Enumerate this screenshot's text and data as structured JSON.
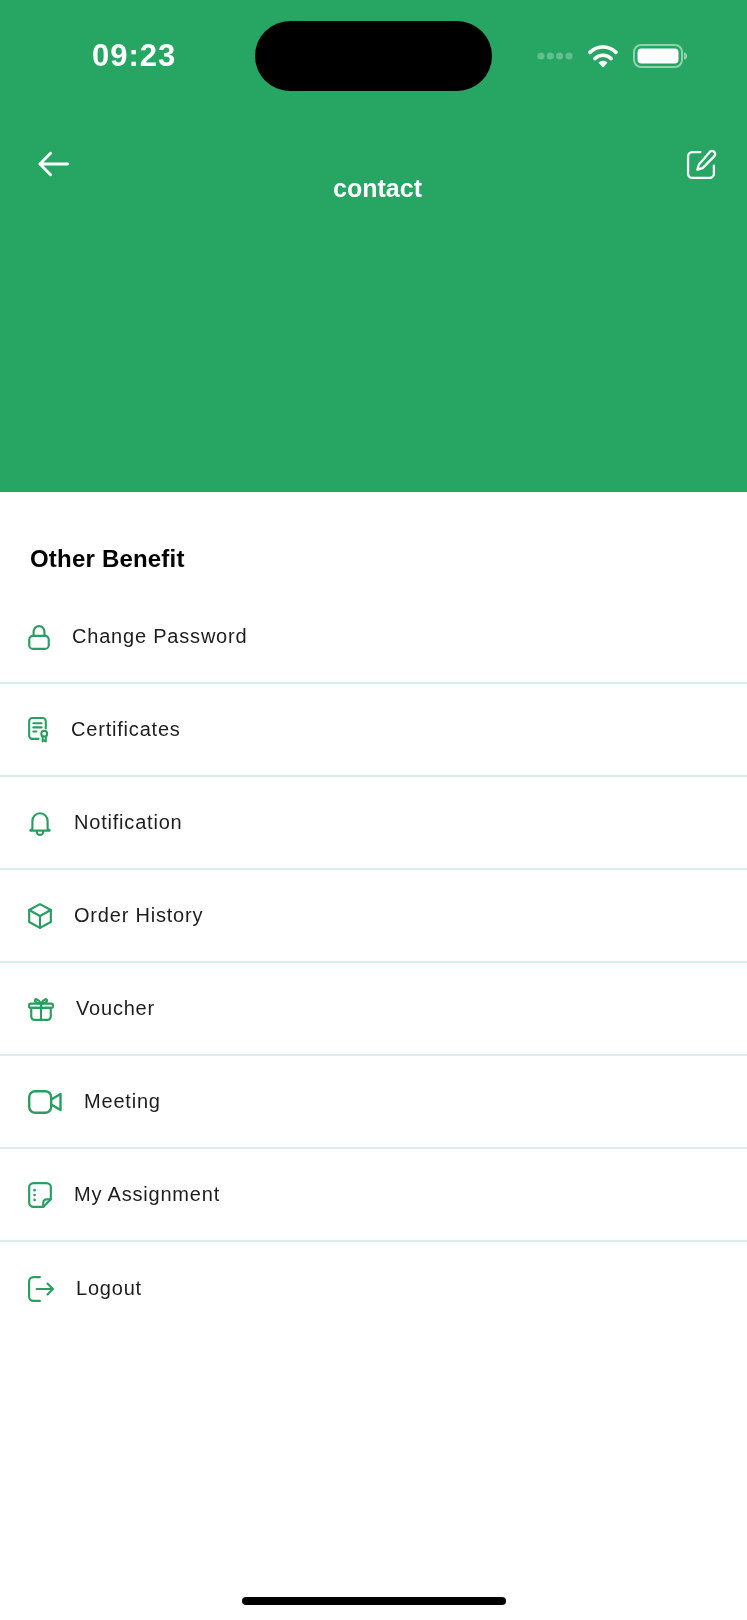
{
  "status_bar": {
    "time": "09:23"
  },
  "header": {
    "title": "contact"
  },
  "section": {
    "title": "Other Benefit",
    "items": [
      {
        "label": "Change Password"
      },
      {
        "label": "Certificates"
      },
      {
        "label": "Notification"
      },
      {
        "label": "Order History"
      },
      {
        "label": "Voucher"
      },
      {
        "label": "Meeting"
      },
      {
        "label": "My Assignment"
      },
      {
        "label": "Logout"
      }
    ]
  }
}
